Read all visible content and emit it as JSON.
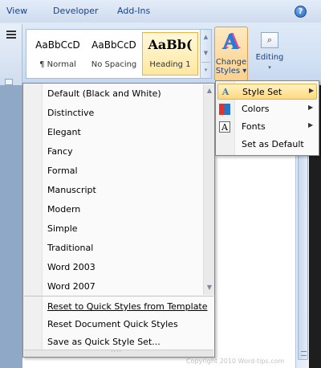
{
  "tabs": {
    "view": "View",
    "developer": "Developer",
    "addins": "Add-Ins",
    "help": "?"
  },
  "quick_styles": [
    {
      "preview": "AaBbCcD",
      "name": "¶ Normal"
    },
    {
      "preview": "AaBbCcD",
      "name": "No Spacing"
    },
    {
      "preview": "AaBb(",
      "name": "Heading 1"
    }
  ],
  "ribbon": {
    "change_styles_icon": "A",
    "change_styles_line1": "Change",
    "change_styles_line2": "Styles ▾",
    "editing_icon": "⌕",
    "editing_label": "Editing",
    "editing_arrow": "▾"
  },
  "style_set_menu": {
    "items": [
      "Default (Black and White)",
      "Distinctive",
      "Elegant",
      "Fancy",
      "Formal",
      "Manuscript",
      "Modern",
      "Simple",
      "Traditional",
      "Word 2003",
      "Word 2007"
    ],
    "commands": [
      "Reset to Quick Styles from Template",
      "Reset Document Quick Styles",
      "Save as Quick Style Set..."
    ],
    "resize_grip": "····"
  },
  "submenu": {
    "items": [
      {
        "label": "Style Set",
        "icon": "style-set-icon",
        "highlighted": true
      },
      {
        "label": "Colors",
        "icon": "colors-icon"
      },
      {
        "label": "Fonts",
        "icon": "fonts-icon"
      },
      {
        "label": "Set as Default"
      }
    ]
  },
  "watermark": "Copyright 2010 Word-tips.com"
}
